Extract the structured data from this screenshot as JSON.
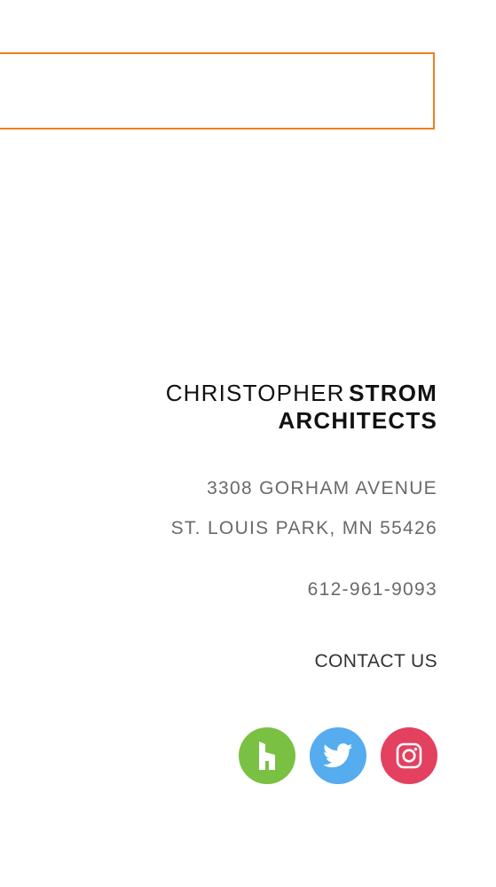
{
  "search_box": {
    "value": ""
  },
  "firm": {
    "name_light": "CHRISTOPHER",
    "name_bold_1": "STROM",
    "name_bold_2": "ARCHITECTS"
  },
  "address": {
    "line1": "3308 GORHAM AVENUE",
    "line2": "ST. LOUIS PARK, MN 55426"
  },
  "phone": "612-961-9093",
  "contact_label": "CONTACT US",
  "social": [
    {
      "name": "houzz-icon",
      "color": "#7ac143"
    },
    {
      "name": "twitter-icon",
      "color": "#55acee"
    },
    {
      "name": "instagram-icon",
      "color": "#e4405f"
    }
  ],
  "colors": {
    "accent_orange": "#ef7f1a",
    "address_text": "#6a6a6a"
  }
}
